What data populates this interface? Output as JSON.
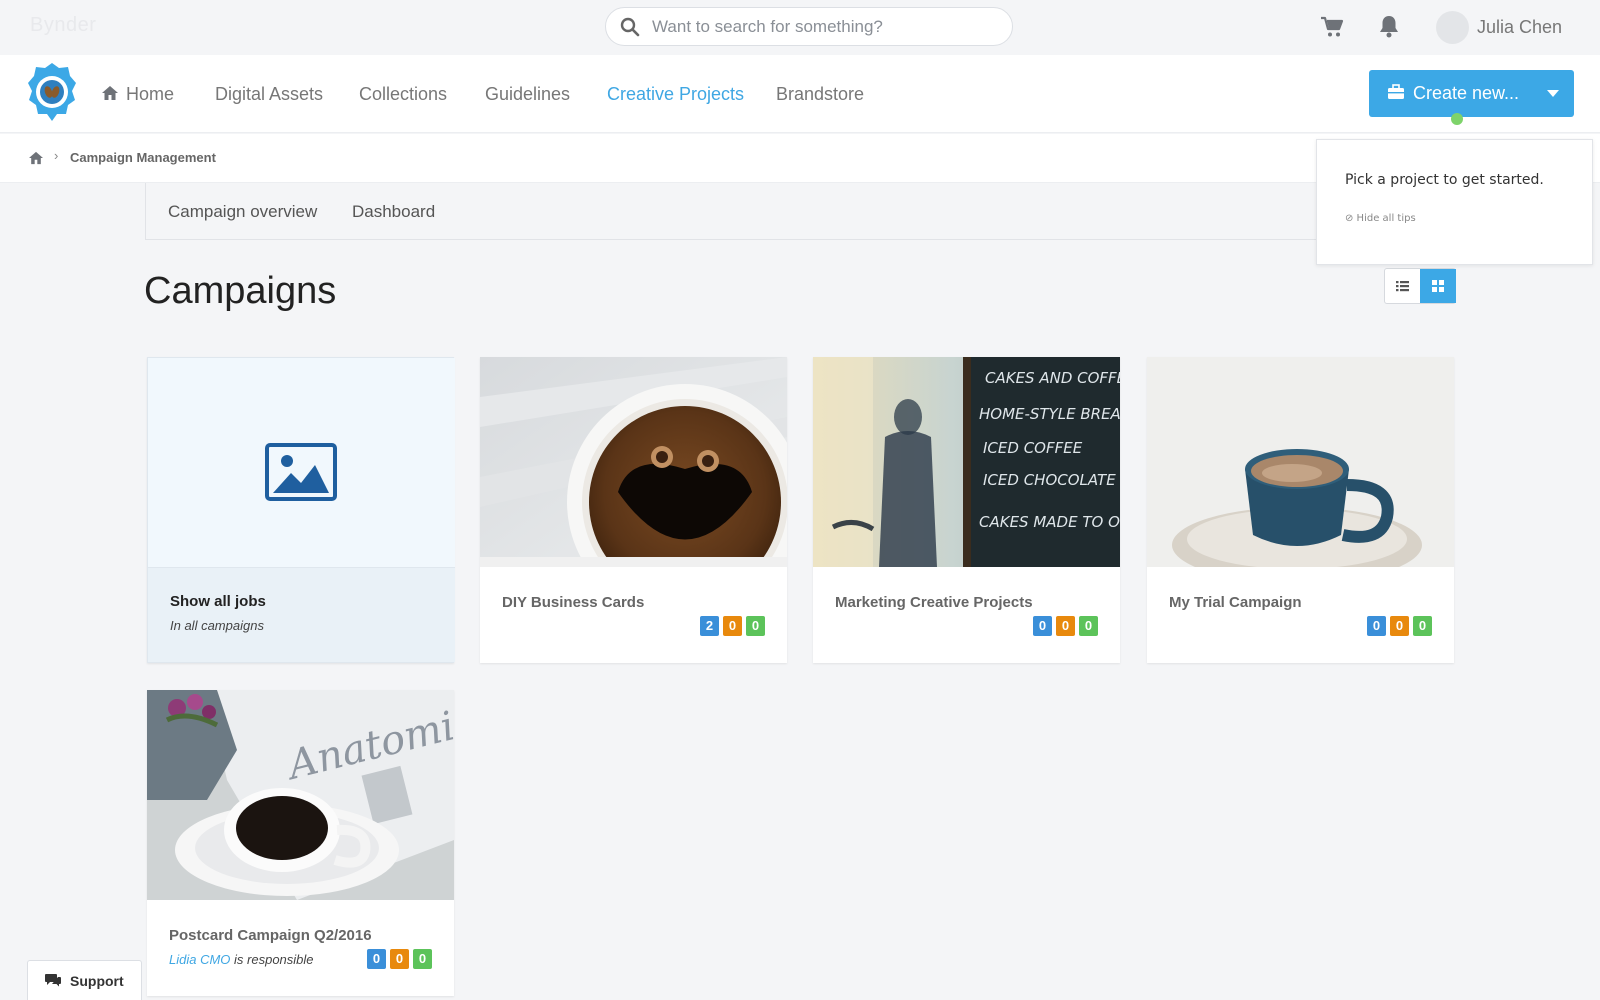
{
  "topbar": {
    "brand_faint": "Bynder",
    "search": {
      "placeholder": "Want to search for something?",
      "value": ""
    },
    "user": {
      "name": "Julia Chen"
    }
  },
  "nav": {
    "items": [
      {
        "label": "Home"
      },
      {
        "label": "Digital Assets"
      },
      {
        "label": "Collections"
      },
      {
        "label": "Guidelines"
      },
      {
        "label": "Creative Projects",
        "active": true
      },
      {
        "label": "Brandstore"
      }
    ],
    "create_label": "Create new..."
  },
  "breadcrumb": {
    "current": "Campaign Management"
  },
  "subtabs": [
    {
      "label": "Campaign overview"
    },
    {
      "label": "Dashboard"
    }
  ],
  "tip": {
    "message": "Pick a project to get started.",
    "hide": "⊘ Hide all tips"
  },
  "page": {
    "title": "Campaigns"
  },
  "cards": [
    {
      "name": "Show all jobs",
      "subtitle": "In all campaigns"
    },
    {
      "name": "DIY Business Cards",
      "badges": [
        "2",
        "0",
        "0"
      ]
    },
    {
      "name": "Marketing Creative Projects",
      "badges": [
        "0",
        "0",
        "0"
      ]
    },
    {
      "name": "My Trial Campaign",
      "badges": [
        "0",
        "0",
        "0"
      ]
    },
    {
      "name": "Postcard Campaign Q2/2016",
      "responsible": "Lidia CMO",
      "responsible_suffix": " is responsible",
      "badges": [
        "0",
        "0",
        "0"
      ]
    }
  ],
  "chalkboard": [
    "CAKES AND COFFEE",
    "HOME-STYLE BREAD",
    "ICED COFFEE",
    "ICED CHOCOLATE",
    "CAKES MADE TO ORDER"
  ],
  "newspaper_text": "Anatomie",
  "support": {
    "label": "Support"
  },
  "colors": {
    "accent": "#3ca8e6",
    "badge_blue": "#3a8fd9",
    "badge_orange": "#e8890d",
    "badge_green": "#5cc35a"
  }
}
